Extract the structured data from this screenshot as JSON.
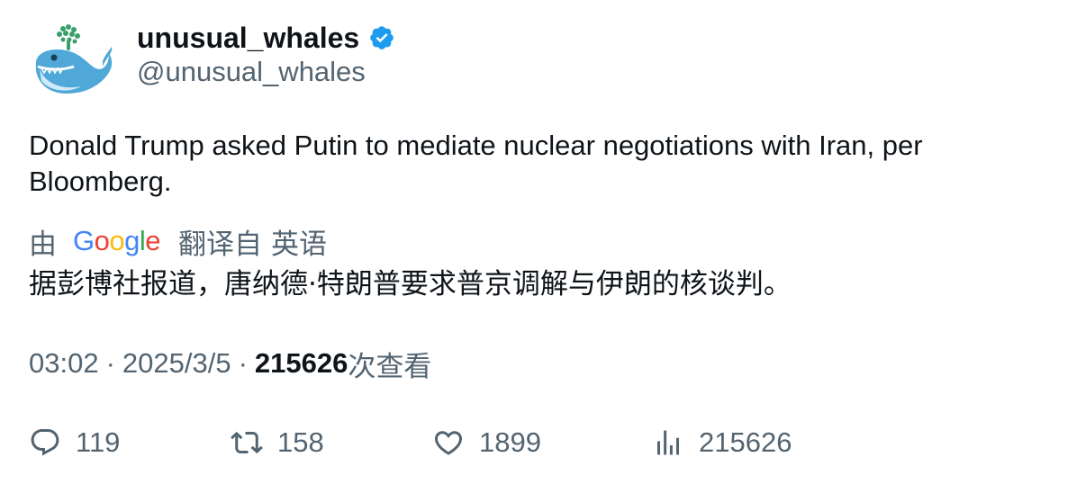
{
  "author": {
    "display_name": "unusual_whales",
    "handle": "@unusual_whales",
    "verified": true,
    "verified_color": "#1d9bf0",
    "avatar_icon": "whale-logo-icon"
  },
  "tweet": {
    "text": "Donald Trump asked Putin to mediate nuclear negotiations with Iran, per Bloomberg."
  },
  "translation": {
    "by_label": "由",
    "provider": "Google",
    "from_label": "翻译自",
    "language": "英语",
    "text": "据彭博社报道，唐纳德·特朗普要求普京调解与伊朗的核谈判。"
  },
  "meta": {
    "time": "03:02",
    "separator": "·",
    "date": "2025/3/5",
    "views_count": "215626",
    "views_label": "次查看"
  },
  "actions": {
    "reply_count": "119",
    "retweet_count": "158",
    "like_count": "1899",
    "views_count": "215626"
  },
  "colors": {
    "text_primary": "#0f1419",
    "text_secondary": "#536471",
    "accent": "#1d9bf0"
  }
}
